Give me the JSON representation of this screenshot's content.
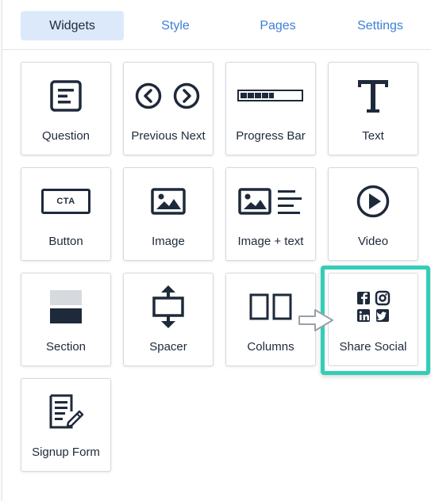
{
  "tabs": [
    {
      "label": "Widgets",
      "active": true
    },
    {
      "label": "Style",
      "active": false
    },
    {
      "label": "Pages",
      "active": false
    },
    {
      "label": "Settings",
      "active": false
    }
  ],
  "widgets": [
    {
      "label": "Question",
      "icon": "question-icon"
    },
    {
      "label": "Previous Next",
      "icon": "previous-next-icon"
    },
    {
      "label": "Progress Bar",
      "icon": "progress-bar-icon",
      "progress": 0.4
    },
    {
      "label": "Text",
      "icon": "text-icon"
    },
    {
      "label": "Button",
      "icon": "button-icon",
      "badge": "CTA"
    },
    {
      "label": "Image",
      "icon": "image-icon"
    },
    {
      "label": "Image + text",
      "icon": "image-text-icon"
    },
    {
      "label": "Video",
      "icon": "video-icon"
    },
    {
      "label": "Section",
      "icon": "section-icon"
    },
    {
      "label": "Spacer",
      "icon": "spacer-icon"
    },
    {
      "label": "Columns",
      "icon": "columns-icon"
    },
    {
      "label": "Share Social",
      "icon": "share-social-icon",
      "highlighted": true
    },
    {
      "label": "Signup Form",
      "icon": "signup-form-icon"
    }
  ],
  "colors": {
    "accent": "#3c7fd6",
    "active_tab_bg": "#dbe9fb",
    "highlight": "#34cdb7",
    "icon": "#1e2a3b"
  }
}
